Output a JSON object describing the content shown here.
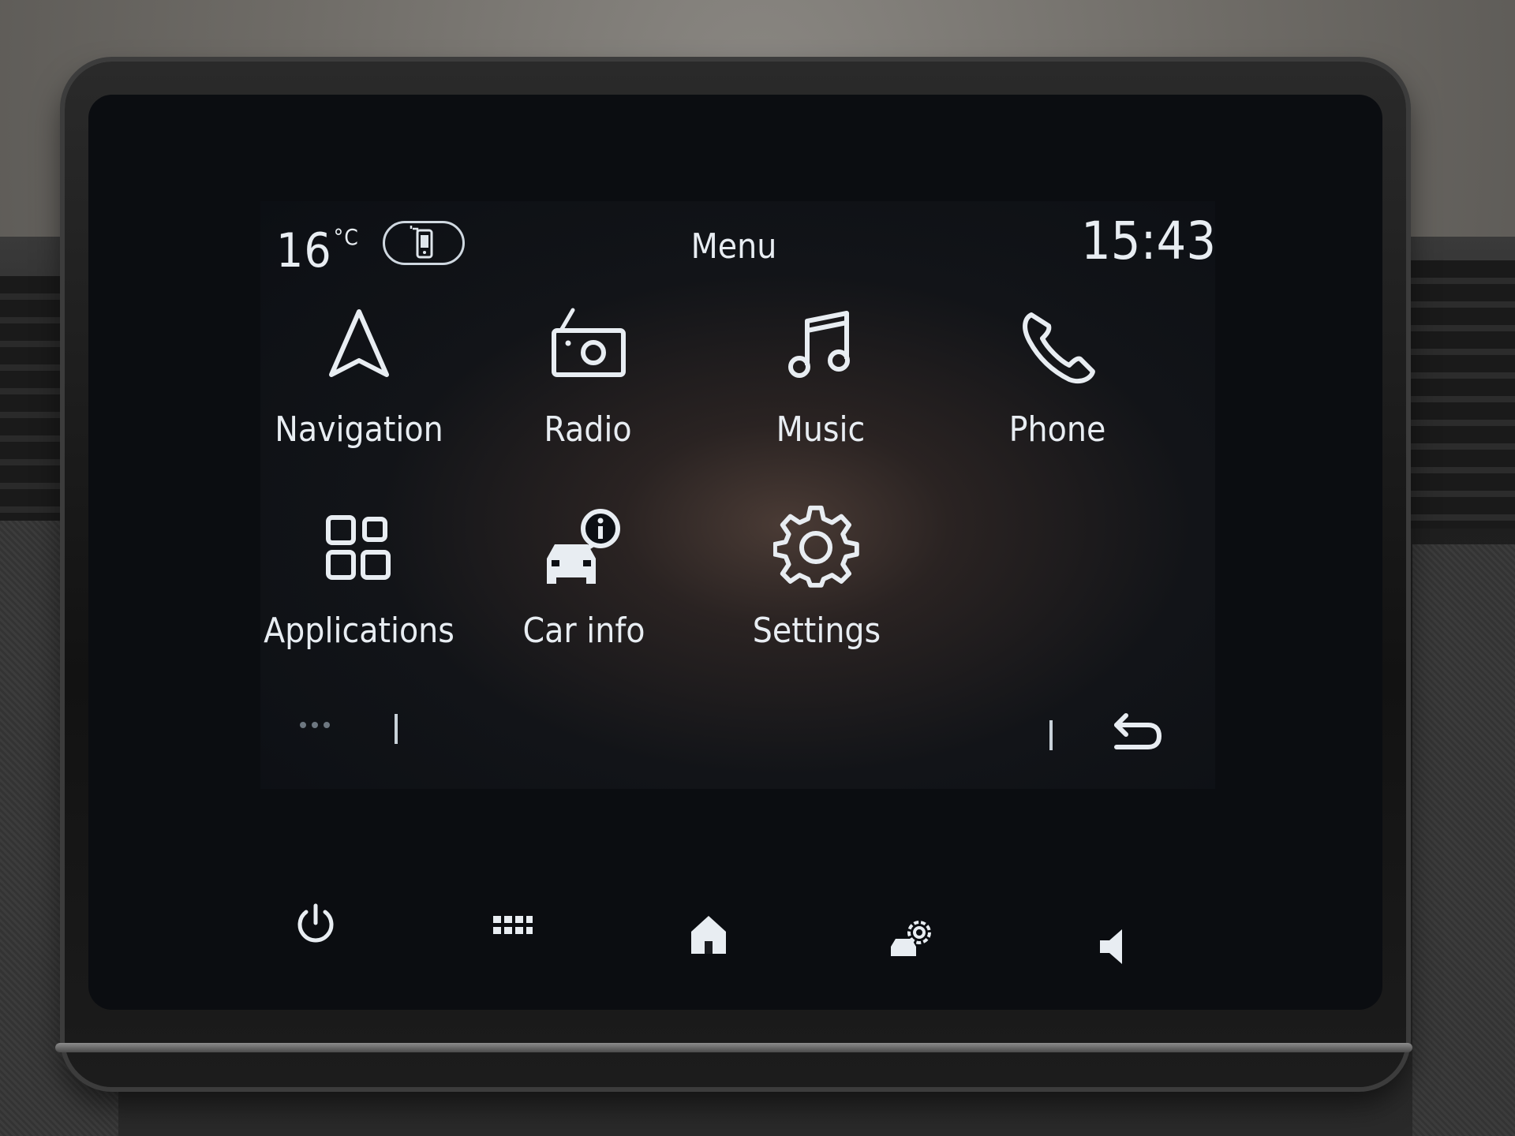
{
  "status": {
    "temperature": "16",
    "temperature_unit": "°C",
    "phone_icon": "smartphone-link-icon",
    "title": "Menu",
    "time": "15:43"
  },
  "menu": {
    "items": [
      {
        "label": "Navigation",
        "icon": "navigation-arrow-icon"
      },
      {
        "label": "Radio",
        "icon": "radio-icon"
      },
      {
        "label": "Music",
        "icon": "music-note-icon"
      },
      {
        "label": "Phone",
        "icon": "phone-handset-icon"
      },
      {
        "label": "Applications",
        "icon": "apps-grid-icon"
      },
      {
        "label": "Car info",
        "icon": "car-info-icon"
      },
      {
        "label": "Settings",
        "icon": "gear-icon"
      }
    ]
  },
  "bottom_bar": {
    "more_icon": "more-dots-icon",
    "back_icon": "back-arrow-icon"
  },
  "hardware_buttons": {
    "items": [
      {
        "icon": "power-icon"
      },
      {
        "icon": "grid-menu-icon"
      },
      {
        "icon": "home-icon"
      },
      {
        "icon": "car-settings-icon"
      },
      {
        "icon": "volume-icon"
      }
    ]
  },
  "colors": {
    "text": "#e8edf2",
    "screen_background": "#0c0f14"
  }
}
